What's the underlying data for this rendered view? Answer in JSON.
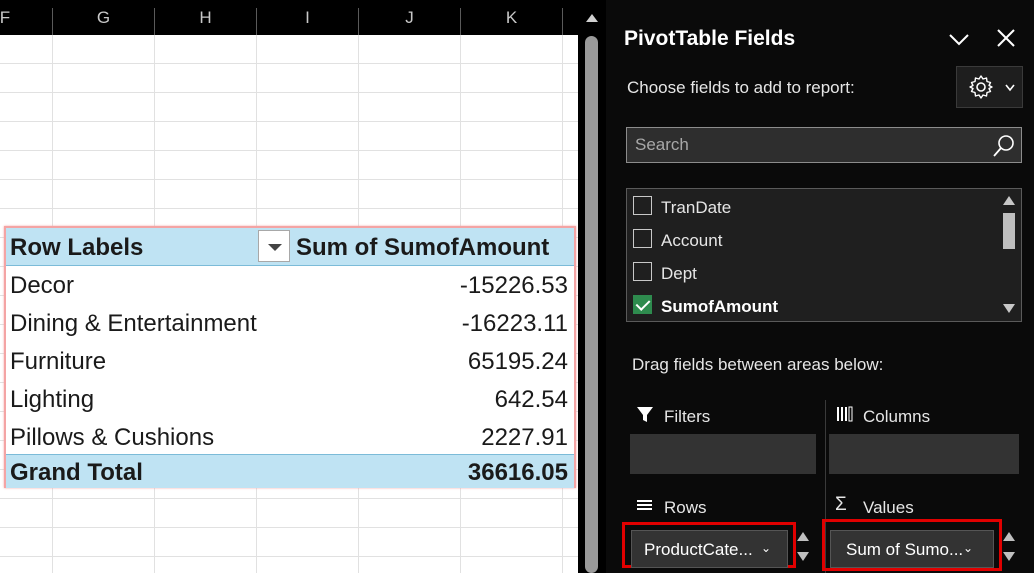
{
  "sheet": {
    "columns": [
      "F",
      "G",
      "H",
      "I",
      "J",
      "K"
    ]
  },
  "pivot": {
    "header_label": "Row Labels",
    "header_value": "Sum of SumofAmount",
    "rows": [
      {
        "label": "Decor",
        "value": "-15226.53"
      },
      {
        "label": "Dining & Entertainment",
        "value": "-16223.11"
      },
      {
        "label": "Furniture",
        "value": "65195.24"
      },
      {
        "label": "Lighting",
        "value": "642.54"
      },
      {
        "label": "Pillows & Cushions",
        "value": "2227.91"
      }
    ],
    "total_label": "Grand Total",
    "total_value": "36616.05"
  },
  "pane": {
    "title": "PivotTable Fields",
    "choose_label": "Choose fields to add to report:",
    "search_placeholder": "Search",
    "fields": [
      {
        "name": "TranDate",
        "checked": false
      },
      {
        "name": "Account",
        "checked": false
      },
      {
        "name": "Dept",
        "checked": false
      },
      {
        "name": "SumofAmount",
        "checked": true
      }
    ],
    "drag_label": "Drag fields between areas below:",
    "areas": {
      "filters_label": "Filters",
      "columns_label": "Columns",
      "rows_label": "Rows",
      "values_label": "Values"
    },
    "rows_chip": "ProductCate...",
    "values_chip": "Sum of Sumo..."
  },
  "colors": {
    "pivot_header_bg": "#bfe3f3",
    "pane_bg": "#0a0a0a",
    "highlight_outline": "#e00000",
    "checkbox_checked": "#2e8b4e"
  },
  "icons": [
    "filter-funnel-icon",
    "columns-icon",
    "rows-icon",
    "sigma-icon",
    "gear-icon",
    "search-icon",
    "close-icon",
    "chevron-down-icon"
  ]
}
